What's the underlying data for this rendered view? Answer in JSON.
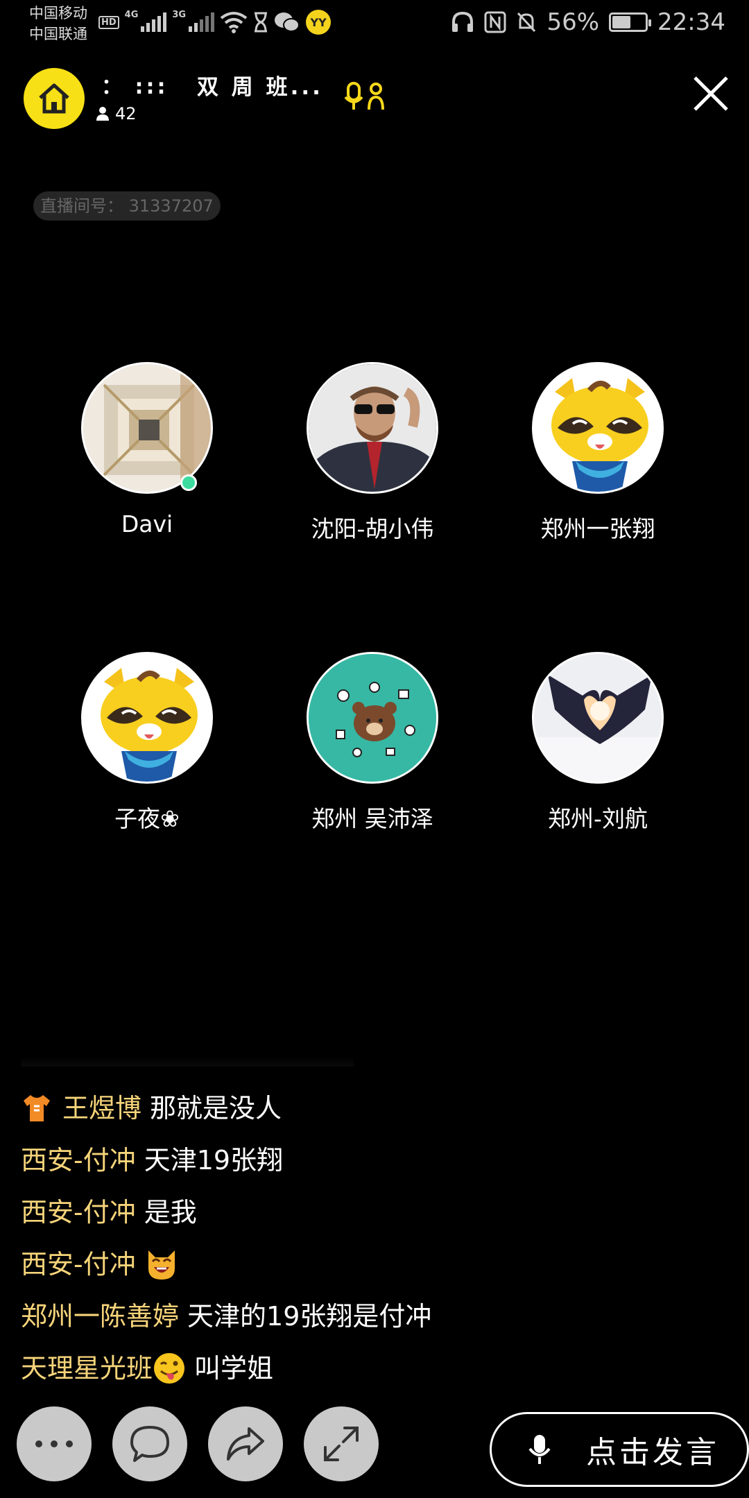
{
  "status_bar": {
    "carrier_1": "中国移动",
    "carrier_2": "中国联通",
    "hd": "HD",
    "net_1": "4G",
    "net_2": "3G",
    "app_badge": "YY",
    "battery_level": 0.56,
    "battery_text": "56%",
    "time": "22:34"
  },
  "header": {
    "room_dots": "：  :::",
    "room_title": "双 周 班...",
    "viewer_count": "42",
    "room_id": "直播间号： 31337207"
  },
  "seats": [
    {
      "name": "Davi",
      "avatar": "building-photo",
      "online": true
    },
    {
      "name": "沈阳-胡小伟",
      "avatar": "man-in-suit-photo",
      "online": false
    },
    {
      "name": "郑州一张翔",
      "avatar": "yy-raccoon-mascot",
      "online": false
    },
    {
      "name": "子夜❀",
      "avatar": "yy-raccoon-mascot",
      "online": false
    },
    {
      "name": "郑州 吴沛泽",
      "avatar": "brown-bear-icons",
      "online": false
    },
    {
      "name": "郑州-刘航",
      "avatar": "heart-hands-photo",
      "online": false
    }
  ],
  "chat": [
    {
      "user": "王煜博",
      "message": "那就是没人",
      "badge": "shirt-icon"
    },
    {
      "user": "西安-付冲",
      "message": "天津19张翔"
    },
    {
      "user": "西安-付冲",
      "message": "是我"
    },
    {
      "user": "西安-付冲",
      "message": "",
      "emoji": "laughing-cat-emoji"
    },
    {
      "user": "郑州一陈善婷",
      "message": "天津的19张翔是付冲"
    },
    {
      "user": "天理星光班",
      "message": "叫学姐",
      "user_emoji": "tongue-wink-emoji"
    }
  ],
  "toolbar": {
    "more": "more-icon",
    "chat": "chat-bubble-icon",
    "share": "share-icon",
    "expand": "expand-icon",
    "talk_label": "点击发言"
  },
  "colors": {
    "brand_yellow": "#f7e016",
    "username": "#f6d47a",
    "online": "#3ddb9e"
  }
}
